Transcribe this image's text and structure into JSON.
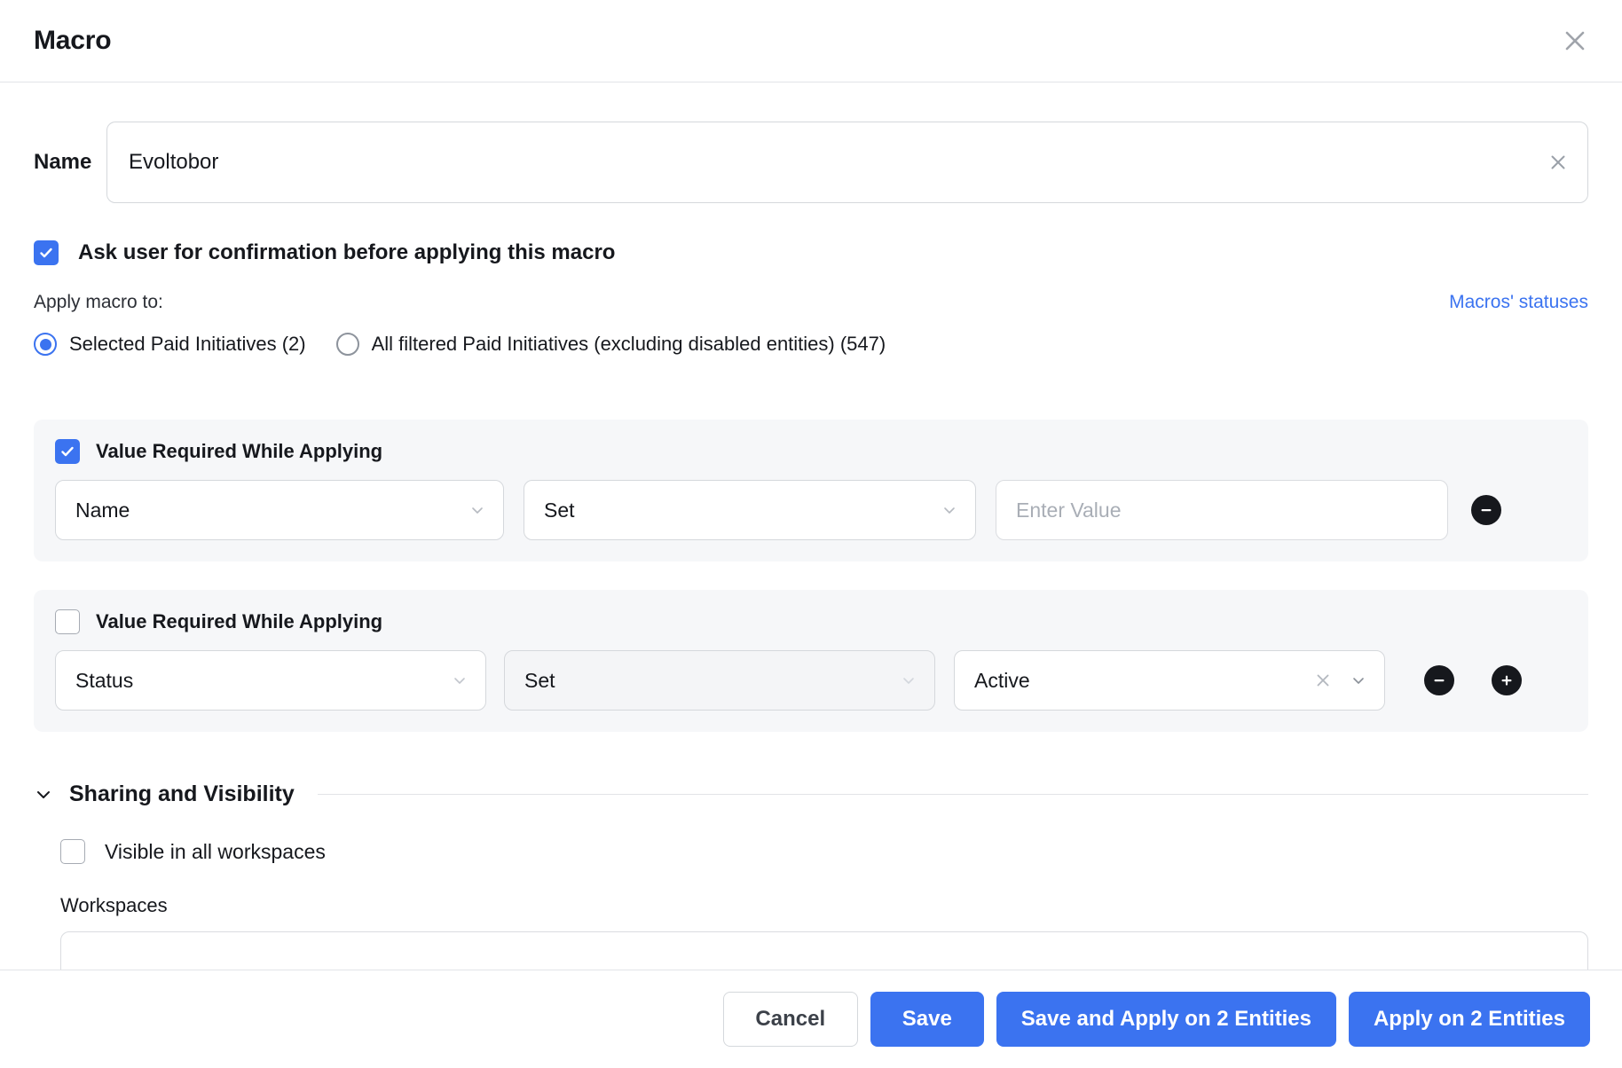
{
  "header": {
    "title": "Macro",
    "close_icon": "close-icon"
  },
  "name_field": {
    "label": "Name",
    "value": "Evoltobor",
    "placeholder": "",
    "clear_icon": "close-icon"
  },
  "confirmation": {
    "label": "Ask user for confirmation before applying this macro",
    "checked": true
  },
  "apply_to": {
    "label": "Apply macro to:",
    "link_label": "Macros' statuses",
    "options": [
      {
        "label": "Selected Paid Initiatives (2)",
        "selected": true
      },
      {
        "label": "All filtered Paid Initiatives (excluding disabled entities) (547)",
        "selected": false
      }
    ]
  },
  "actions": [
    {
      "value_required_label": "Value Required While Applying",
      "value_required_checked": true,
      "field": "Name",
      "operation": "Set",
      "value": "",
      "value_placeholder": "Enter Value",
      "remove_label": "−",
      "has_add": false
    },
    {
      "value_required_label": "Value Required While Applying",
      "value_required_checked": false,
      "field": "Status",
      "operation": "Set",
      "value": "Active",
      "value_placeholder": "",
      "remove_label": "−",
      "add_label": "+",
      "has_add": true
    }
  ],
  "sharing": {
    "section_title": "Sharing and Visibility",
    "visible_all_label": "Visible in all workspaces",
    "visible_all_checked": false,
    "workspaces_label": "Workspaces",
    "workspaces_value": ""
  },
  "footer": {
    "cancel_label": "Cancel",
    "save_label": "Save",
    "save_apply_label": "Save and Apply on 2 Entities",
    "apply_label": "Apply on 2 Entities"
  },
  "colors": {
    "accent": "#3b73f0",
    "panel": "#f6f7f9",
    "text": "#16181d",
    "border": "#d5d8dc"
  }
}
